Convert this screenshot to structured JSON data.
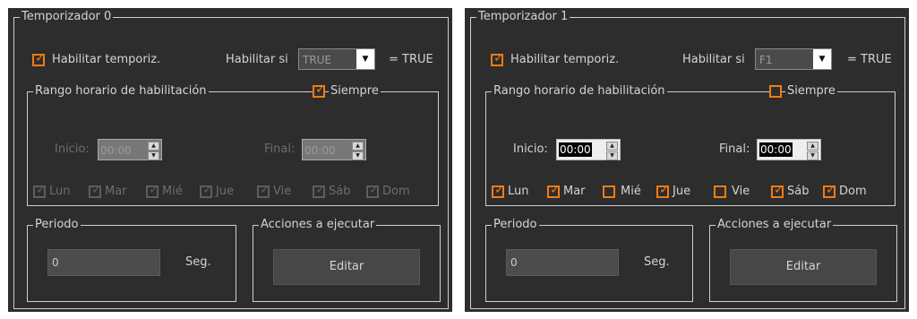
{
  "timers": [
    {
      "title": "Temporizador 0",
      "enable_label": "Habilitar temporiz.",
      "enable_checked": true,
      "enable_if_label": "Habilitar si",
      "enable_if_value": "TRUE",
      "equals_label": "= TRUE",
      "range_title": "Rango horario de habilitación",
      "always_label": "Siempre",
      "always_checked": true,
      "start_label": "Inicio:",
      "start_value": "00:00",
      "end_label": "Final:",
      "end_value": "00:00",
      "days": [
        {
          "label": "Lun",
          "checked": true
        },
        {
          "label": "Mar",
          "checked": true
        },
        {
          "label": "Mié",
          "checked": true
        },
        {
          "label": "Jue",
          "checked": true
        },
        {
          "label": "Vie",
          "checked": true
        },
        {
          "label": "Sáb",
          "checked": true
        },
        {
          "label": "Dom",
          "checked": true
        }
      ],
      "days_enabled": false,
      "period_title": "Periodo",
      "period_value": "0",
      "period_unit": "Seg.",
      "actions_title": "Acciones a ejecutar",
      "edit_label": "Editar"
    },
    {
      "title": "Temporizador 1",
      "enable_label": "Habilitar temporiz.",
      "enable_checked": true,
      "enable_if_label": "Habilitar si",
      "enable_if_value": "F1",
      "equals_label": "= TRUE",
      "range_title": "Rango horario de habilitación",
      "always_label": "Siempre",
      "always_checked": false,
      "start_label": "Inicio:",
      "start_value": "00:00",
      "end_label": "Final:",
      "end_value": "00:00",
      "days": [
        {
          "label": "Lun",
          "checked": true
        },
        {
          "label": "Mar",
          "checked": true
        },
        {
          "label": "Mié",
          "checked": false
        },
        {
          "label": "Jue",
          "checked": true
        },
        {
          "label": "Vie",
          "checked": false
        },
        {
          "label": "Sáb",
          "checked": true
        },
        {
          "label": "Dom",
          "checked": true
        }
      ],
      "days_enabled": true,
      "period_title": "Periodo",
      "period_value": "0",
      "period_unit": "Seg.",
      "actions_title": "Acciones a ejecutar",
      "edit_label": "Editar"
    }
  ],
  "colors": {
    "accent": "#f07c14",
    "panel_bg": "#2d2d2d",
    "disabled": "#5e5e5e"
  },
  "icons": {
    "check": "check-icon",
    "dropdown": "chevron-down-icon",
    "spin_up": "spin-up-icon",
    "spin_down": "spin-down-icon"
  }
}
